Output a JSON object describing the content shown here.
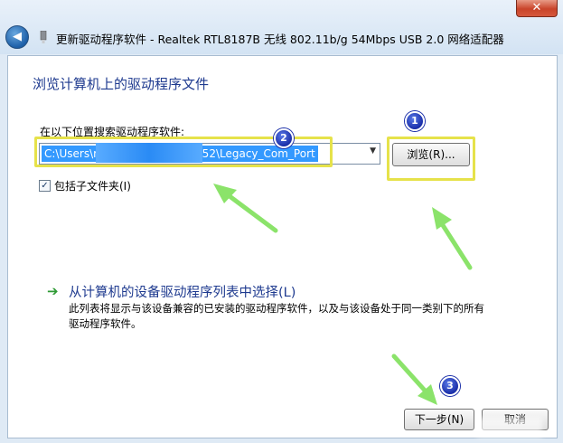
{
  "window": {
    "title": "更新驱动程序软件 - Realtek RTL8187B 无线 802.11b/g 54Mbps USB 2.0 网络适配器",
    "close_glyph": "✕",
    "back_glyph": "◀"
  },
  "page": {
    "heading": "浏览计算机上的驱动程序文件",
    "search_label": "在以下位置搜索驱动程序软件:",
    "path_value_start": "C:\\Users\\r",
    "path_value_end": "952\\Legacy_Com_Port",
    "browse_label": "浏览(R)...",
    "include_subfolders_label": "包括子文件夹(I)",
    "include_subfolders_checked": true,
    "pick_link_title": "从计算机的设备驱动程序列表中选择(L)",
    "pick_link_desc": "此列表将显示与该设备兼容的已安装的驱动程序软件，以及与该设备处于同一类别下的所有驱动程序软件。"
  },
  "footer": {
    "next_label": "下一步(N)",
    "cancel_label": "取消"
  },
  "annotations": {
    "badge_1": "1",
    "badge_2": "2",
    "badge_3": "3",
    "highlight_color": "#e6e24a",
    "arrow_color": "#7fe05a"
  },
  "icons": {
    "back": "back-arrow-icon",
    "device": "usb-device-icon",
    "dropdown": "chevron-down-icon",
    "link": "green-arrow-icon"
  }
}
